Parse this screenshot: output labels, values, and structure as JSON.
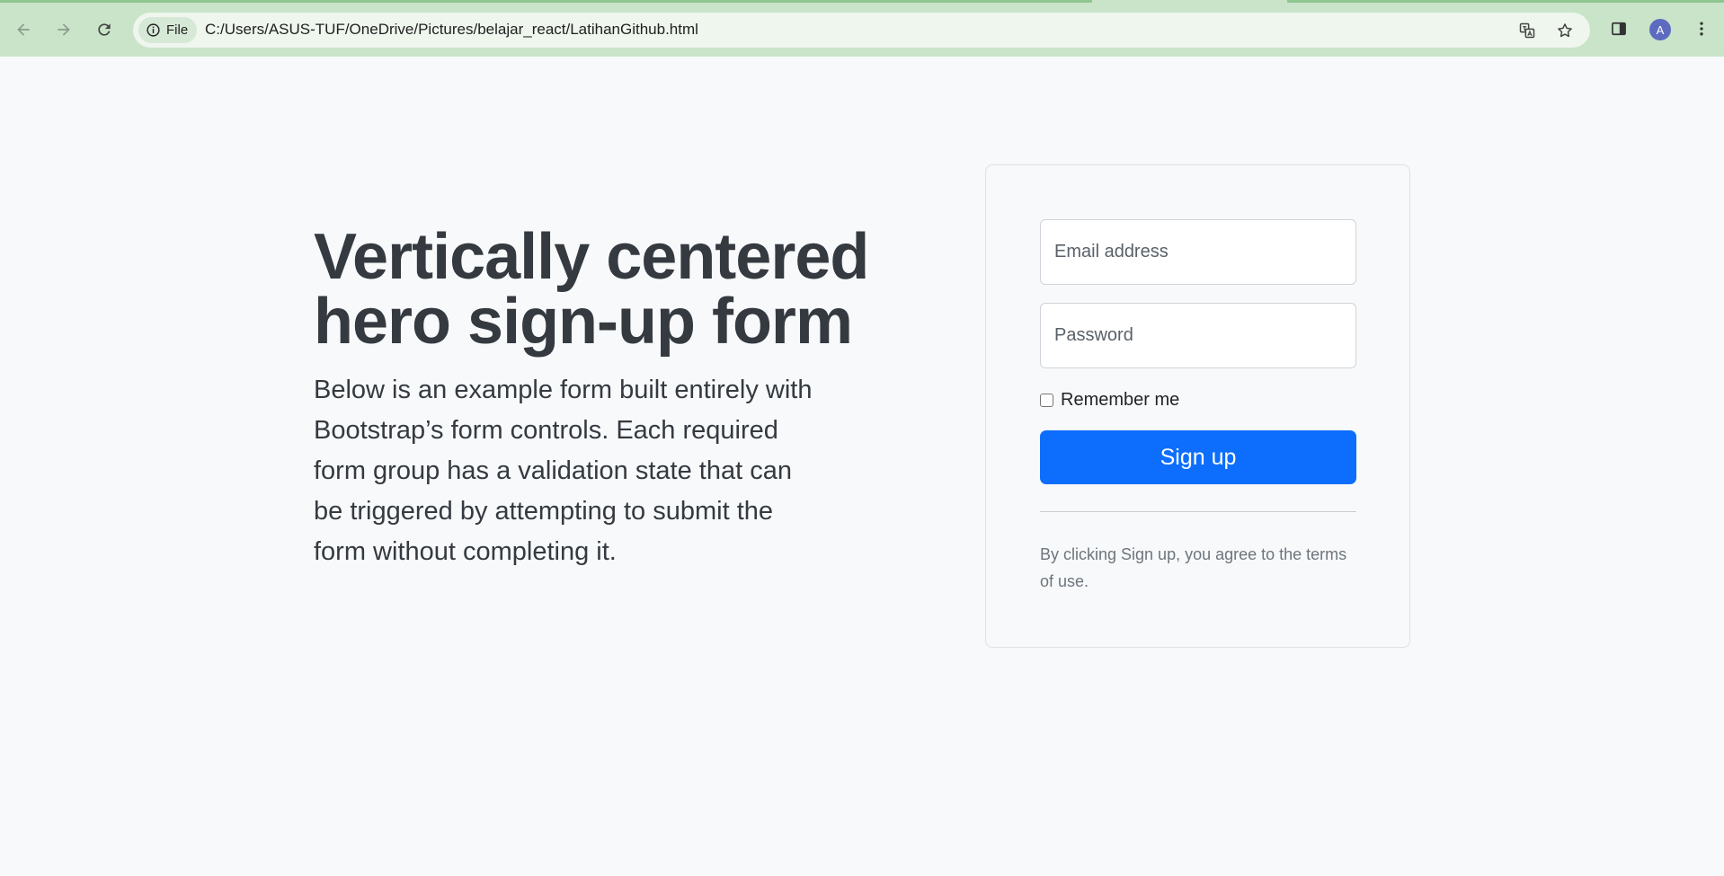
{
  "browser": {
    "back_icon": "arrow-left-icon",
    "forward_icon": "arrow-right-icon",
    "reload_icon": "reload-icon",
    "site_info_label": "File",
    "url": "C:/Users/ASUS-TUF/OneDrive/Pictures/belajar_react/LatihanGithub.html",
    "profile_initial": "A",
    "icons": [
      "translate-icon",
      "star-icon",
      "side-panel-icon",
      "more-vert-icon"
    ]
  },
  "hero": {
    "title_line1": "Vertically centered",
    "title_line2": "hero sign-up form",
    "lead": "Below is an example form built entirely with Bootstrap’s form controls. Each required form group has a validation state that can be triggered by attempting to submit the form without completing it."
  },
  "form": {
    "email_placeholder": "Email address",
    "password_placeholder": "Password",
    "remember_label": "Remember me",
    "signup_label": "Sign up",
    "terms_text": "By clicking Sign up, you agree to the terms of use."
  },
  "colors": {
    "primary": "#0d6efd",
    "chrome": "#c9e4c9",
    "page_bg": "#f8f9fa"
  }
}
